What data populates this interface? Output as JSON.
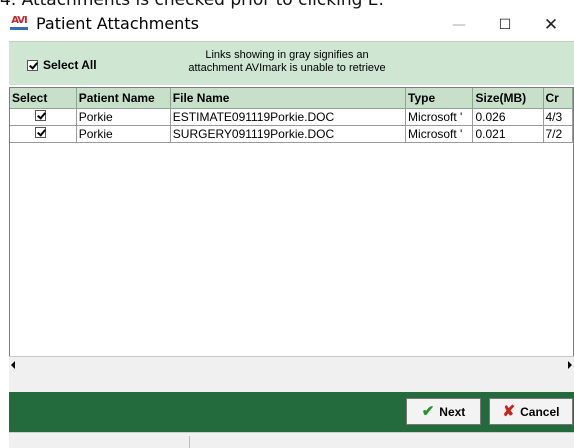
{
  "background_caption": "4. Attachments is checked prior to clicking E.",
  "window": {
    "title": "Patient Attachments",
    "app_icon_text": "AVI"
  },
  "header": {
    "select_all_label": "Select All",
    "select_all_checked": true,
    "notice_line1": "Links showing in gray signifies an",
    "notice_line2": "attachment AVImark is unable to retrieve"
  },
  "table": {
    "columns": [
      "Select",
      "Patient Name",
      "File Name",
      "Type",
      "Size(MB)",
      "Cr"
    ],
    "rows": [
      {
        "checked": true,
        "patient": "Porkie",
        "file": "ESTIMATE091119Porkie.DOC",
        "type": "Microsoft '",
        "size": "0.026",
        "created": "4/3"
      },
      {
        "checked": true,
        "patient": "Porkie",
        "file": "SURGERY091119Porkie.DOC",
        "type": "Microsoft '",
        "size": "0.021",
        "created": "7/2"
      }
    ]
  },
  "footer": {
    "next_label": "Next",
    "cancel_label": "Cancel"
  },
  "colors": {
    "header_panel": "#cfe6d3",
    "column_header": "#c8dfc9",
    "footer": "#236b3d",
    "title_icon": "#c0262c"
  }
}
